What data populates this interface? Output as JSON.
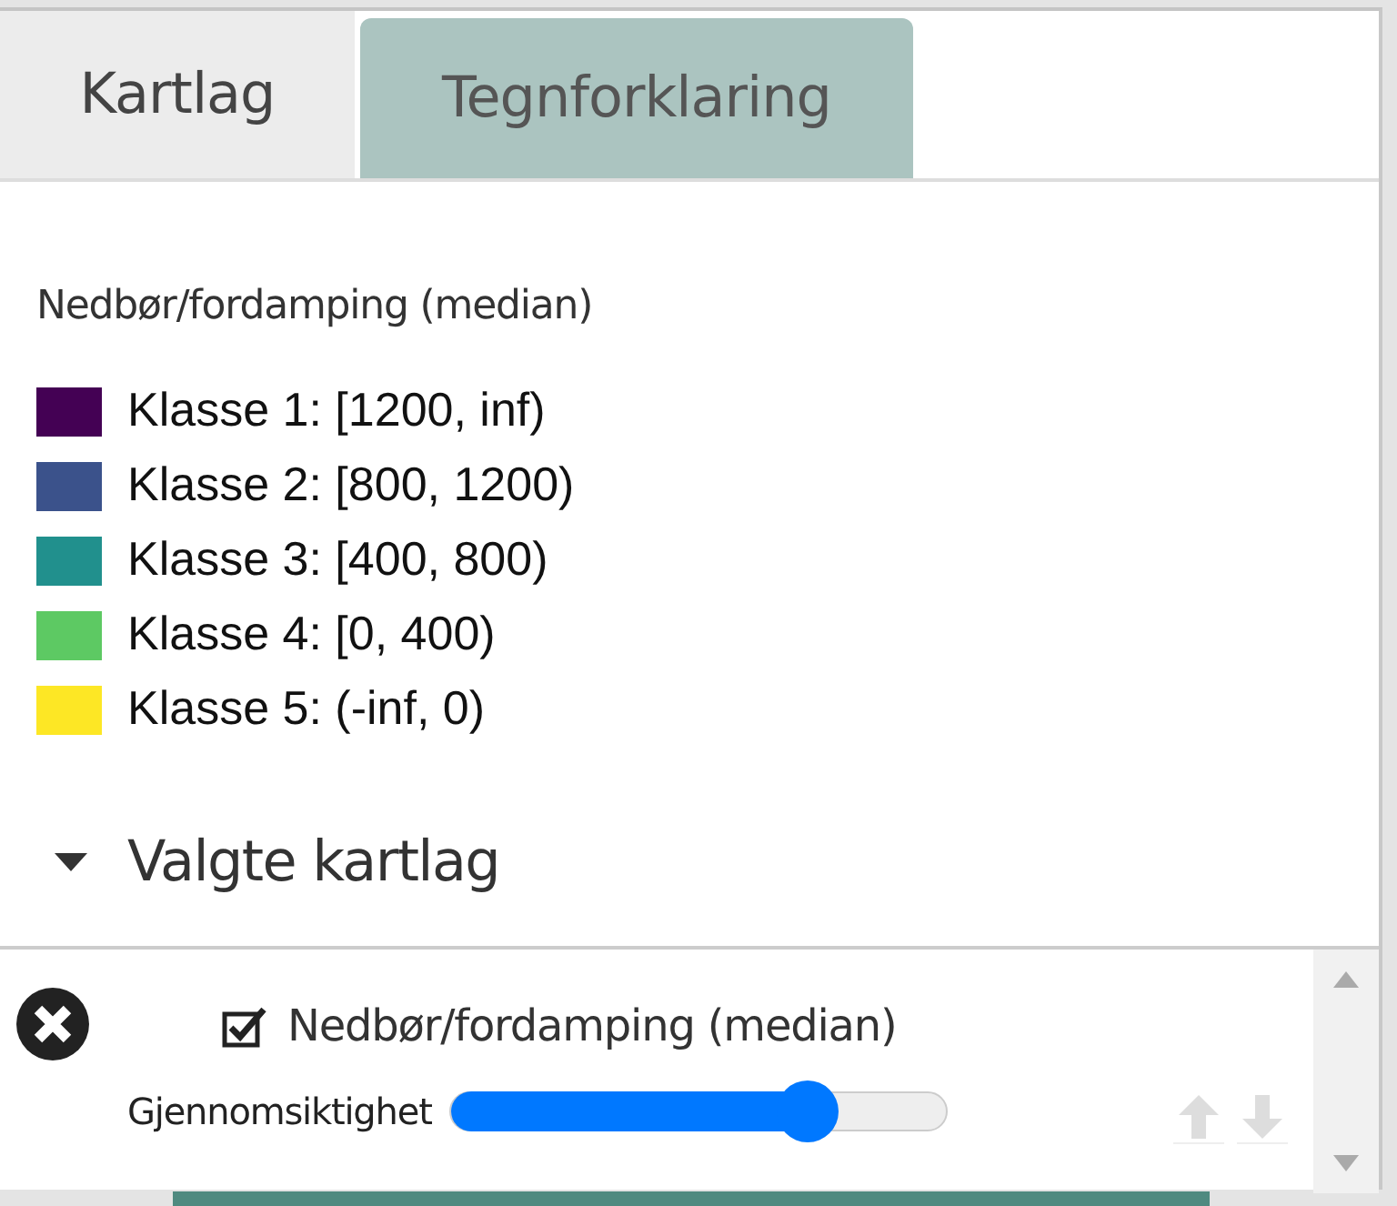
{
  "tabs": [
    {
      "label": "Kartlag",
      "selected": false
    },
    {
      "label": "Tegnforklaring",
      "selected": true
    }
  ],
  "legend": {
    "title": "Nedbør/fordamping (median)",
    "classes": [
      {
        "label": "Klasse 1: [1200, inf)",
        "color": "#440154"
      },
      {
        "label": "Klasse 2: [800, 1200)",
        "color": "#3b528b"
      },
      {
        "label": "Klasse 3: [400, 800)",
        "color": "#21908d"
      },
      {
        "label": "Klasse 4: [0, 400)",
        "color": "#5dc963"
      },
      {
        "label": "Klasse 5: (-inf, 0)",
        "color": "#fde725"
      }
    ]
  },
  "selected_layers": {
    "title": "Valgte kartlag",
    "expanded": true,
    "layers": [
      {
        "name": "Nedbør/fordamping (median)",
        "checked": true,
        "opacity_label": "Gjennomsiktighet",
        "level": 0.72,
        "move_up_disabled": true,
        "move_down_disabled": true
      }
    ]
  }
}
